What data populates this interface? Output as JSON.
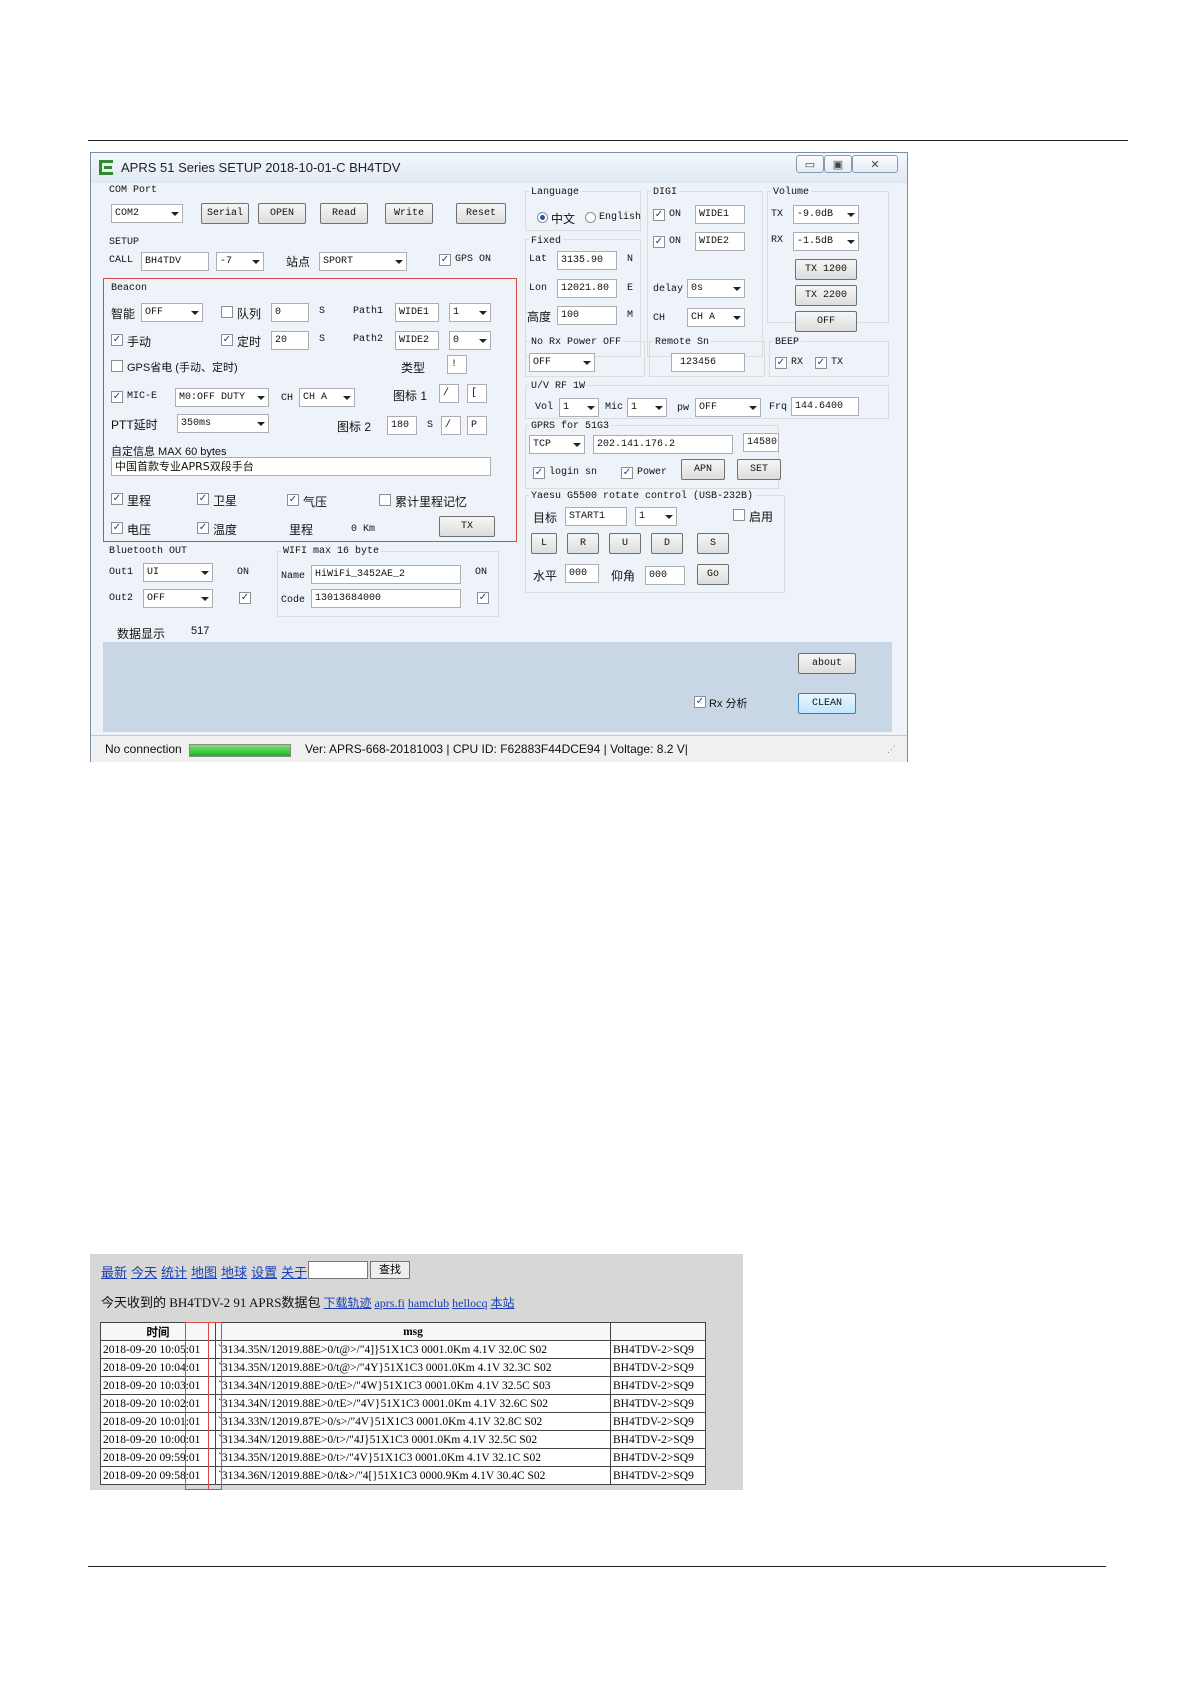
{
  "window": {
    "title": "APRS   51 Series SETUP 2018-10-01-C BH4TDV",
    "controls": [
      "▭",
      "▣",
      "✕"
    ]
  },
  "com": {
    "label": "COM Port",
    "port": "COM2",
    "buttons": [
      "Serial",
      "OPEN",
      "Read",
      "Write",
      "Reset"
    ]
  },
  "setup": {
    "label": "SETUP",
    "call_label": "CALL",
    "call": "BH4TDV",
    "ssid": "-7",
    "station_label": "站点",
    "station": "SPORT",
    "gps_on_label": "GPS ON"
  },
  "beacon": {
    "label": "Beacon",
    "smart_label": "智能",
    "smart": "OFF",
    "queue_label": "队列",
    "queue": "0",
    "queue_unit": "S",
    "path1_label": "Path1",
    "path1": "WIDE1",
    "path1_n": "1",
    "manual_label": "手动",
    "timed_label": "定时",
    "timed": "20",
    "timed_unit": "S",
    "path2_label": "Path2",
    "path2": "WIDE2",
    "path2_n": "0",
    "gps_save_label": "GPS省电 (手动、定时)",
    "type_label": "类型",
    "type": "!",
    "mic_e_label": "MIC-E",
    "mic_e": "M0:OFF DUTY",
    "ch_label": "CH",
    "ch": "CH A",
    "icon1_label": "图标 1",
    "icon1_a": "/",
    "icon1_b": "[",
    "ptt_label": "PTT延时",
    "ptt": "350ms",
    "icon2_label": "图标 2",
    "icon2_val": "180",
    "icon2_unit": "S",
    "icon2_a": "/",
    "icon2_b": "P",
    "custom_label": "自定信息  MAX 60 bytes",
    "custom": "中国首款专业APRS双段手台",
    "opt_mileage": "里程",
    "opt_satellite": "卫星",
    "opt_pressure": "气压",
    "opt_mileage_mem": "累计里程记忆",
    "opt_voltage": "电压",
    "opt_temperature": "温度",
    "mileage_label": "里程",
    "mileage": "0 Km",
    "tx_button": "TX"
  },
  "bluetooth": {
    "label": "Bluetooth OUT",
    "out1_label": "Out1",
    "out1": "UI",
    "out1_state": "ON",
    "out2_label": "Out2",
    "out2": "OFF"
  },
  "wifi": {
    "label": "WIFI max 16 byte",
    "name_label": "Name",
    "name": "HiWiFi_3452AE_2",
    "name_state": "ON",
    "code_label": "Code",
    "code": "13013684000"
  },
  "data_display": {
    "label": "数据显示",
    "value": "517"
  },
  "language": {
    "label": "Language",
    "zh": "中文",
    "en": "English"
  },
  "fixed": {
    "label": "Fixed",
    "lat_label": "Lat",
    "lat": "3135.90",
    "lat_dir": "N",
    "lon_label": "Lon",
    "lon": "12021.80",
    "lon_dir": "E",
    "alt_label": "高度",
    "alt": "100",
    "alt_unit": "M"
  },
  "digi": {
    "label": "DIGI",
    "on1": "ON",
    "wide1": "WIDE1",
    "on2": "ON",
    "wide2": "WIDE2",
    "delay_label": "delay",
    "delay": "0s",
    "ch_label": "CH",
    "ch": "CH A"
  },
  "volume": {
    "label": "Volume",
    "tx_label": "TX",
    "tx": "-9.0dB",
    "rx_label": "RX",
    "rx": "-1.5dB",
    "buttons": [
      "TX 1200",
      "TX 2200",
      "OFF"
    ]
  },
  "no_rx": {
    "label": "No Rx Power OFF",
    "value": "OFF"
  },
  "remote": {
    "label": "Remote Sn",
    "value": "123456"
  },
  "beep": {
    "label": "BEEP",
    "rx": "RX",
    "tx": "TX"
  },
  "uv": {
    "label": "U/V RF 1W",
    "vol_label": "Vol",
    "vol": "1",
    "mic_label": "Mic",
    "mic": "1",
    "pw_label": "pw",
    "pw": "OFF",
    "frq_label": "Frq",
    "frq": "144.6400"
  },
  "gprs": {
    "label": "GPRS for 51G3",
    "proto": "TCP",
    "ip": "202.141.176.2",
    "port": "14580",
    "login_label": "login sn",
    "power_label": "Power",
    "apn": "APN",
    "set": "SET"
  },
  "yaesu": {
    "label": "Yaesu G5500 rotate control   (USB-232B)",
    "target_label": "目标",
    "target": "START1",
    "target_n": "1",
    "enable_label": "启用",
    "buttons": [
      "L",
      "R",
      "U",
      "D",
      "S"
    ],
    "horiz_label": "水平",
    "horiz": "000",
    "elev_label": "仰角",
    "elev": "000",
    "go": "Go"
  },
  "bottom": {
    "about": "about",
    "rx_analysis": "Rx 分析",
    "clean": "CLEAN"
  },
  "status": {
    "connection": "No connection",
    "progress": 1.0,
    "info": "Ver: APRS-668-20181003 | CPU ID: F62883F44DCE94 | Voltage: 8.2 V|"
  },
  "web": {
    "nav": [
      "最新",
      "今天",
      "统计",
      "地图",
      "地球",
      "设置",
      "关于"
    ],
    "search_button": "查找",
    "headline": "今天收到的 BH4TDV-2 91 APRS数据包",
    "links": [
      "下载轨迹",
      "aprs.fi",
      "hamclub",
      "hellocq",
      "本站"
    ],
    "table_headers": [
      "时间",
      "msg",
      ""
    ],
    "rows": [
      [
        "2018-09-20 10:05:01",
        "`3134.35N/12019.88E>0/t@>/\"4]}51X1C3 0001.0Km 4.1V 32.0C S02",
        "BH4TDV-2>SQ9"
      ],
      [
        "2018-09-20 10:04:01",
        "`3134.35N/12019.88E>0/t@>/\"4Y}51X1C3 0001.0Km 4.1V 32.3C S02",
        "BH4TDV-2>SQ9"
      ],
      [
        "2018-09-20 10:03:01",
        "`3134.34N/12019.88E>0/tE>/\"4W}51X1C3 0001.0Km 4.1V 32.5C S03",
        "BH4TDV-2>SQ9"
      ],
      [
        "2018-09-20 10:02:01",
        "`3134.34N/12019.88E>0/tE>/\"4V}51X1C3 0001.0Km 4.1V 32.6C S02",
        "BH4TDV-2>SQ9"
      ],
      [
        "2018-09-20 10:01:01",
        "`3134.33N/12019.87E>0/s>/\"4V}51X1C3 0001.0Km 4.1V 32.8C S02",
        "BH4TDV-2>SQ9"
      ],
      [
        "2018-09-20 10:00:01",
        "`3134.34N/12019.88E>0/t>/\"4J}51X1C3 0001.0Km 4.1V 32.5C S02",
        "BH4TDV-2>SQ9"
      ],
      [
        "2018-09-20 09:59:01",
        "`3134.35N/12019.88E>0/t>/\"4V}51X1C3 0001.0Km 4.1V 32.1C S02",
        "BH4TDV-2>SQ9"
      ],
      [
        "2018-09-20 09:58:01",
        "`3134.36N/12019.88E>0/t&>/\"4[}51X1C3 0000.9Km 4.1V 30.4C S02",
        "BH4TDV-2>SQ9"
      ]
    ]
  },
  "colors": {
    "beacon_border": "#d84a4a",
    "link": "#1b3fb5",
    "progress": "#19b519"
  }
}
